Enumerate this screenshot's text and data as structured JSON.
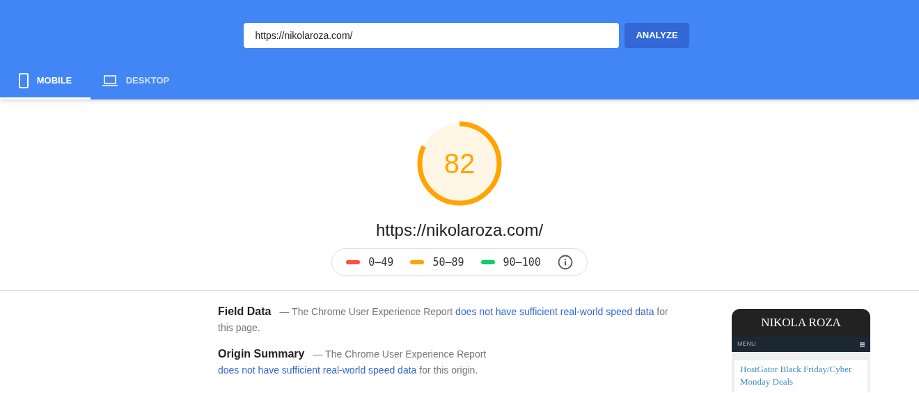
{
  "search": {
    "value": "https://nikolaroza.com/",
    "button": "ANALYZE"
  },
  "tabs": [
    {
      "label": "MOBILE",
      "kind": "mobile",
      "selected": true
    },
    {
      "label": "DESKTOP",
      "kind": "desktop",
      "selected": false
    }
  ],
  "score": {
    "value": "82",
    "level": 0.82,
    "url": "https://nikolaroza.com/"
  },
  "legend": [
    {
      "label": "0–49",
      "color": "#ff4e42"
    },
    {
      "label": "50–89",
      "color": "#ffa400"
    },
    {
      "label": "90–100",
      "color": "#0cce6b"
    }
  ],
  "sections": [
    {
      "title": "Field Data",
      "text": "— The Chrome User Experience Report ",
      "link": "does not have sufficient real-world speed data",
      "after": " for this page."
    },
    {
      "title": "Origin Summary",
      "text": "— The Chrome User Experience Report ",
      "link": "does not have sufficient real-world speed data",
      "after": " for this origin."
    }
  ],
  "preview": {
    "site_title": "NIKOLA ROZA",
    "menu": "MENU",
    "post_title": "HostGator Black Friday/Cyber Monday Deals"
  }
}
